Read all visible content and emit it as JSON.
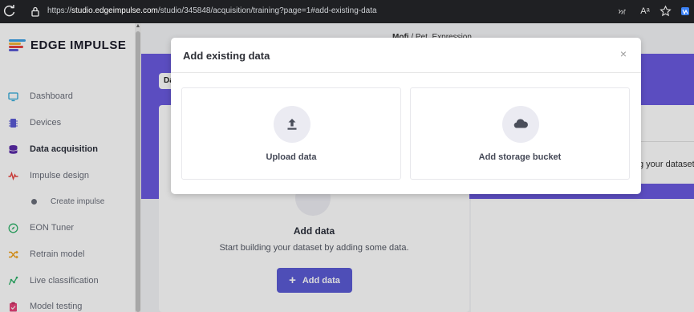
{
  "browser": {
    "url_prefix": "https://",
    "url_host": "studio.edgeimpulse.com",
    "url_path": "/studio/345848/acquisition/training?page=1#add-existing-data",
    "read_aloud": "Aᵃ"
  },
  "sidebar": {
    "logo_text": "EDGE IMPULSE",
    "items": [
      {
        "label": "Dashboard",
        "icon": "monitor-icon"
      },
      {
        "label": "Devices",
        "icon": "chip-icon"
      },
      {
        "label": "Data acquisition",
        "icon": "database-icon"
      },
      {
        "label": "Impulse design",
        "icon": "pulse-icon"
      },
      {
        "label": "Create impulse",
        "icon": "dot-icon"
      },
      {
        "label": "EON Tuner",
        "icon": "compass-icon"
      },
      {
        "label": "Retrain model",
        "icon": "shuffle-icon"
      },
      {
        "label": "Live classification",
        "icon": "graph-icon"
      },
      {
        "label": "Model testing",
        "icon": "clipboard-icon"
      }
    ]
  },
  "main": {
    "breadcrumb_project": "Mofi",
    "breadcrumb_sep": "/",
    "breadcrumb_page": "Pet_Expression",
    "tab_chip": "Da",
    "card_title": "Add data",
    "card_desc": "Start building your dataset by adding some data.",
    "add_button": "Add data",
    "right_text": "g your dataset"
  },
  "modal": {
    "title": "Add existing data",
    "close": "×",
    "options": [
      {
        "label": "Upload data",
        "icon": "upload-icon"
      },
      {
        "label": "Add storage bucket",
        "icon": "cloud-icon"
      }
    ]
  },
  "colors": {
    "accent": "#6a5ae0",
    "button": "#5b5bd6"
  }
}
